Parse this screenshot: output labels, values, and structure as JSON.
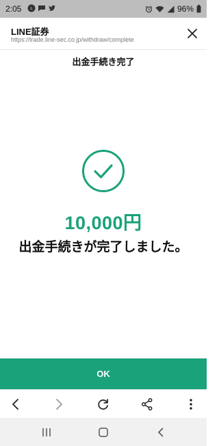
{
  "status_bar": {
    "time": "2:05",
    "battery": "96%"
  },
  "browser": {
    "site_title": "LINE証券",
    "url": "https://trade.line-sec.co.jp/withdraw/complete"
  },
  "page": {
    "title": "出金手続き完了",
    "amount": "10,000円",
    "message": "出金手続きが完了しました。",
    "ok_label": "OK"
  },
  "colors": {
    "accent": "#1aa27a",
    "status_bar_bg": "#bdbdbd"
  },
  "icons": {
    "status_left": [
      "line-app-icon",
      "message-icon",
      "twitter-icon"
    ],
    "status_right": [
      "alarm-icon",
      "wifi-icon",
      "signal-icon"
    ],
    "toolbar": [
      "back-icon",
      "forward-icon",
      "reload-icon",
      "share-icon",
      "more-vertical-icon"
    ],
    "nav": [
      "recent-apps-icon",
      "home-icon",
      "nav-back-icon"
    ]
  }
}
